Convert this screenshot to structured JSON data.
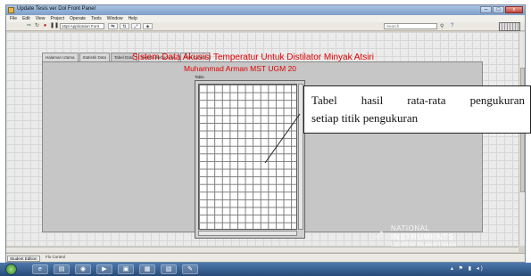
{
  "window": {
    "title": "Update Tesis ver Dol Front Panel"
  },
  "menubar": {
    "items": [
      "File",
      "Edit",
      "View",
      "Project",
      "Operate",
      "Tools",
      "Window",
      "Help"
    ]
  },
  "toolbar": {
    "font_select": "15pt Application Font",
    "search_placeholder": "Search"
  },
  "tabs": {
    "items": [
      "Halaman Utama",
      "Statistik Data",
      "Tabel Data",
      "Deteksi Kebocoran",
      "Flow Control"
    ],
    "active_index": 2
  },
  "panel": {
    "heading": "Sistem Data Akusisi Temperatur Untuk Distilator Minyak Atsiri",
    "subheading": "Muhammad Arman MST UGM 20",
    "table_label": "Table"
  },
  "callout": {
    "line1_words": [
      "Tabel",
      "hasil",
      "rata-rata",
      "pengukuran"
    ],
    "line2": "setiap titik pengukuran"
  },
  "ni_logo": {
    "line1": "NATIONAL",
    "line2": "INSTRUMENTS",
    "line3": "LabVIEW Student Edition"
  },
  "statusbar": {
    "left": "Student Edition",
    "left2": "Flo Control"
  },
  "colors": {
    "heading": "#e00000",
    "panel_bg": "#c6c6c6",
    "taskbar": "#274a78"
  }
}
